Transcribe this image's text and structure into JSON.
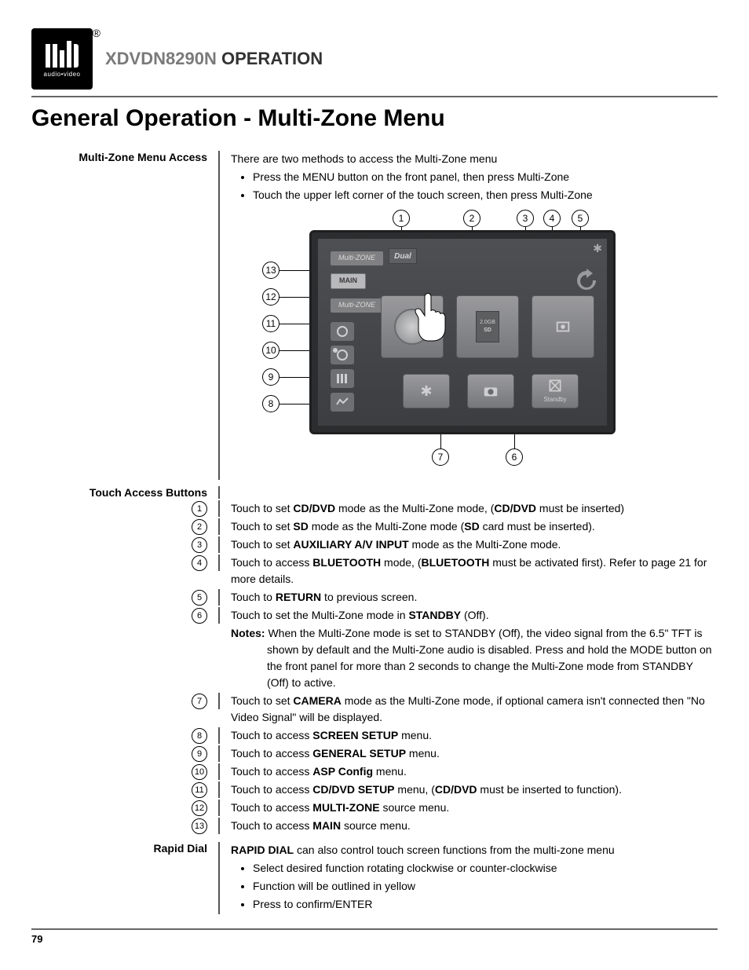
{
  "logo": {
    "subtext": "audio•video",
    "reg": "®"
  },
  "header": {
    "model": "XDVDN8290N",
    "title": "OPERATION"
  },
  "page_title": "General Operation - Multi-Zone Menu",
  "access": {
    "label": "Multi-Zone Menu Access",
    "intro": "There are two methods to access the Multi-Zone menu",
    "bullet1": "Press the MENU button on the front panel, then press Multi-Zone",
    "bullet2": "Touch the upper left corner of the touch screen, then press Multi-Zone"
  },
  "diagram": {
    "tab_multizone_top": "Multi-ZONE",
    "tab_main": "MAIN",
    "tab_multizone_mid": "Multi-ZONE",
    "sd_label": "2.0GB",
    "sd_sub": "SD",
    "standby": "Standby",
    "brand": "Dual",
    "callouts_top": [
      "1",
      "2",
      "3",
      "4",
      "5"
    ],
    "callouts_left": [
      "13",
      "12",
      "11",
      "10",
      "9",
      "8"
    ],
    "callouts_bottom": [
      "7",
      "6"
    ]
  },
  "touch": {
    "label": "Touch Access Buttons",
    "items": [
      {
        "n": "1",
        "pre": "Touch to set ",
        "b1": "CD/DVD",
        "mid": " mode as the Multi-Zone mode, (",
        "b2": "CD/DVD",
        "post": " must be inserted)"
      },
      {
        "n": "2",
        "pre": "Touch to set ",
        "b1": "SD",
        "mid": " mode as the Multi-Zone mode (",
        "b2": "SD",
        "post": " card must be inserted)."
      },
      {
        "n": "3",
        "pre": "Touch to set ",
        "b1": "AUXILIARY A/V INPUT",
        "mid": " mode as the Multi-Zone mode.",
        "b2": "",
        "post": ""
      },
      {
        "n": "4",
        "pre": "Touch to access ",
        "b1": "BLUETOOTH",
        "mid": " mode, (",
        "b2": "BLUETOOTH",
        "post": " must be activated first). Refer to page 21 for more details."
      },
      {
        "n": "5",
        "pre": "Touch to ",
        "b1": "RETURN",
        "mid": " to previous screen.",
        "b2": "",
        "post": ""
      },
      {
        "n": "6",
        "pre": "Touch to set the Multi-Zone mode in ",
        "b1": "STANDBY",
        "mid": " (Off).",
        "b2": "",
        "post": ""
      }
    ],
    "notes_label": "Notes:",
    "notes_text": " When the Multi-Zone mode is set to STANDBY (Off), the video signal from the 6.5\" TFT is shown by default and the Multi-Zone audio is disabled. Press and hold the MODE button on the front panel for more than 2 seconds to change the Multi-Zone mode from STANDBY (Off) to active.",
    "items2": [
      {
        "n": "7",
        "pre": "Touch to set ",
        "b1": "CAMERA",
        "mid": " mode as the Multi-Zone mode, if optional camera isn't connected then \"No Video Signal\" will be displayed.",
        "b2": "",
        "post": ""
      },
      {
        "n": "8",
        "pre": "Touch to access ",
        "b1": "SCREEN SETUP",
        "mid": " menu.",
        "b2": "",
        "post": ""
      },
      {
        "n": "9",
        "pre": "Touch to access ",
        "b1": "GENERAL SETUP",
        "mid": " menu.",
        "b2": "",
        "post": ""
      },
      {
        "n": "10",
        "pre": "Touch to access ",
        "b1": "ASP Config",
        "mid": " menu.",
        "b2": "",
        "post": ""
      },
      {
        "n": "11",
        "pre": "Touch to access ",
        "b1": "CD/DVD SETUP",
        "mid": " menu, (",
        "b2": "CD/DVD",
        "post": " must be inserted to function)."
      },
      {
        "n": "12",
        "pre": "Touch to access ",
        "b1": "MULTI-ZONE",
        "mid": " source menu.",
        "b2": "",
        "post": ""
      },
      {
        "n": "13",
        "pre": "Touch to access ",
        "b1": "MAIN",
        "mid": " source menu.",
        "b2": "",
        "post": ""
      }
    ]
  },
  "rapid": {
    "label": "Rapid Dial",
    "intro_b": "RAPID DIAL",
    "intro_rest": " can also control touch screen functions from the multi-zone menu",
    "b1": "Select desired function rotating clockwise or counter-clockwise",
    "b2": "Function will be outlined in yellow",
    "b3": "Press to confirm/ENTER"
  },
  "page_number": "79"
}
